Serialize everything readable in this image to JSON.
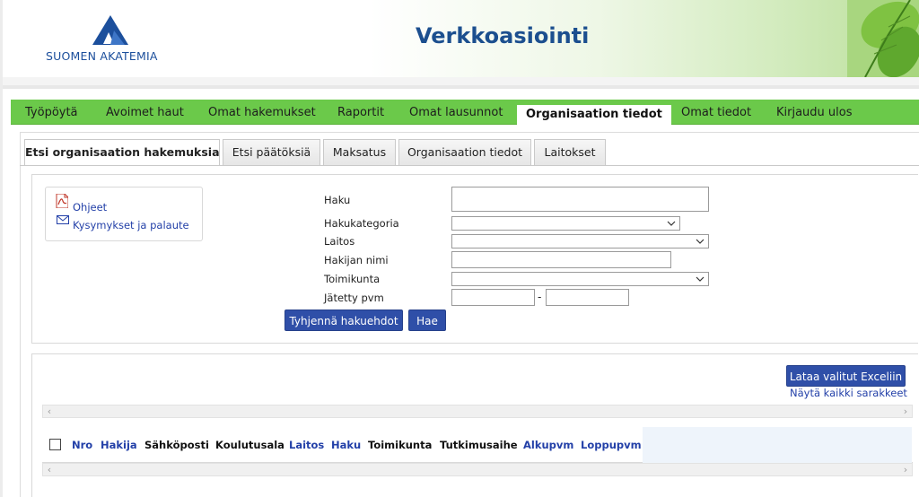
{
  "header": {
    "logo_text": "SUOMEN AKATEMIA",
    "app_title": "Verkkoasiointi"
  },
  "main_nav": [
    {
      "label": "Työpöytä",
      "active": false
    },
    {
      "label": "Avoimet haut",
      "active": false
    },
    {
      "label": "Omat hakemukset",
      "active": false
    },
    {
      "label": "Raportit",
      "active": false
    },
    {
      "label": "Omat lausunnot",
      "active": false
    },
    {
      "label": "Organisaation tiedot",
      "active": true
    },
    {
      "label": "Omat tiedot",
      "active": false
    },
    {
      "label": "Kirjaudu ulos",
      "active": false
    }
  ],
  "sub_tabs": [
    {
      "label": "Etsi organisaation hakemuksia",
      "active": true
    },
    {
      "label": "Etsi päätöksiä",
      "active": false
    },
    {
      "label": "Maksatus",
      "active": false
    },
    {
      "label": "Organisaation tiedot",
      "active": false
    },
    {
      "label": "Laitokset",
      "active": false
    }
  ],
  "help": {
    "instructions": "Ohjeet",
    "feedback": "Kysymykset ja palaute"
  },
  "form": {
    "haku_label": "Haku",
    "haku_value": "",
    "hakukategoria_label": "Hakukategoria",
    "hakukategoria_value": "",
    "laitos_label": "Laitos",
    "laitos_value": "",
    "hakijan_nimi_label": "Hakijan nimi",
    "hakijan_nimi_value": "",
    "toimikunta_label": "Toimikunta",
    "toimikunta_value": "",
    "jatetty_pvm_label": "Jätetty pvm",
    "date_from": "",
    "date_to": "",
    "date_separator": "-",
    "clear_button": "Tyhjennä hakuehdot",
    "search_button": "Hae"
  },
  "results": {
    "excel_button": "Lataa valitut Exceliin",
    "show_all_columns": "Näytä kaikki sarakkeet",
    "columns": [
      {
        "label": "Nro",
        "sortable": true
      },
      {
        "label": "Hakija",
        "sortable": true
      },
      {
        "label": "Sähköposti",
        "sortable": false
      },
      {
        "label": "Koulutusala",
        "sortable": false
      },
      {
        "label": "Laitos",
        "sortable": true
      },
      {
        "label": "Haku",
        "sortable": true
      },
      {
        "label": "Toimikunta",
        "sortable": false
      },
      {
        "label": "Tutkimusaihe",
        "sortable": false
      },
      {
        "label": "Alkupvm",
        "sortable": true
      },
      {
        "label": "Loppupvm",
        "sortable": true
      }
    ]
  },
  "colors": {
    "nav_green": "#6bc94a",
    "brand_blue": "#1c4f8f",
    "button_blue": "#2f4fa8",
    "link_blue": "#2340a8"
  },
  "icons": {
    "logo": "triangle-logo",
    "instructions": "pdf-icon",
    "feedback": "mail-icon",
    "dropdown": "chevron-down-icon",
    "scroll_left": "scroll-left-arrow",
    "scroll_right": "scroll-right-arrow"
  }
}
